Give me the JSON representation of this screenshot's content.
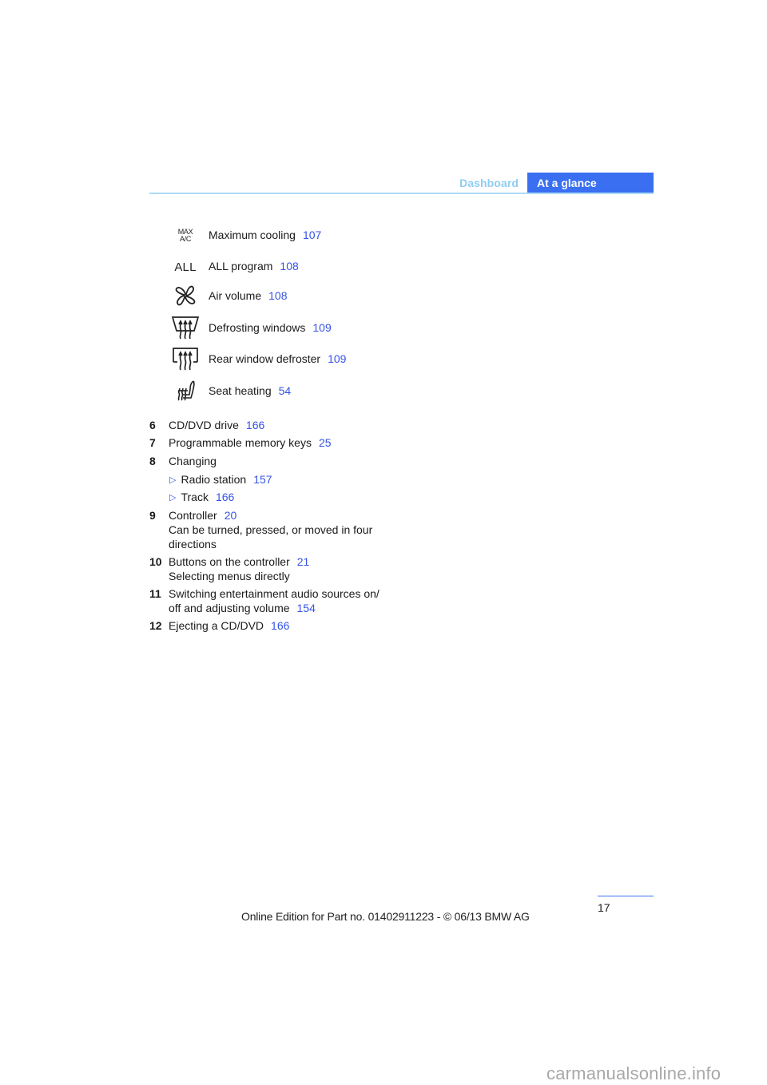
{
  "header": {
    "section": "Dashboard",
    "chapter": "At a glance"
  },
  "icon_items": [
    {
      "icon": "max-ac-icon",
      "icon_text_line1": "MAX",
      "icon_text_line2": "A/C",
      "label": "Maximum cooling",
      "ref": "107"
    },
    {
      "icon": "all-program-icon",
      "icon_text": "ALL",
      "label": "ALL program",
      "ref": "108"
    },
    {
      "icon": "fan-icon",
      "label": "Air volume",
      "ref": "108"
    },
    {
      "icon": "windshield-defrost-icon",
      "label": "Defrosting windows",
      "ref": "109"
    },
    {
      "icon": "rear-window-defrost-icon",
      "label": "Rear window defroster",
      "ref": "109"
    },
    {
      "icon": "seat-heating-icon",
      "label": "Seat heating",
      "ref": "54"
    }
  ],
  "items": [
    {
      "num": "6",
      "text": "CD/DVD drive",
      "ref": "166"
    },
    {
      "num": "7",
      "text": "Programmable memory keys",
      "ref": "25"
    },
    {
      "num": "8",
      "text": "Changing",
      "subitems": [
        {
          "bullet": "▷",
          "text": "Radio station",
          "ref": "157"
        },
        {
          "bullet": "▷",
          "text": "Track",
          "ref": "166"
        }
      ]
    },
    {
      "num": "9",
      "text": "Controller",
      "ref": "20",
      "desc_lines": [
        "Can be turned, pressed, or moved in four",
        "directions"
      ]
    },
    {
      "num": "10",
      "text": "Buttons on the controller",
      "ref": "21",
      "desc_lines": [
        "Selecting menus directly"
      ]
    },
    {
      "num": "11",
      "text_lines": [
        "Switching entertainment audio sources on/",
        "off and adjusting volume"
      ],
      "ref": "154"
    },
    {
      "num": "12",
      "text": "Ejecting a CD/DVD",
      "ref": "166"
    }
  ],
  "page_number": "17",
  "footer": "Online Edition for Part no. 01402911223 - © 06/13 BMW AG",
  "watermark": "carmanualsonline.info"
}
